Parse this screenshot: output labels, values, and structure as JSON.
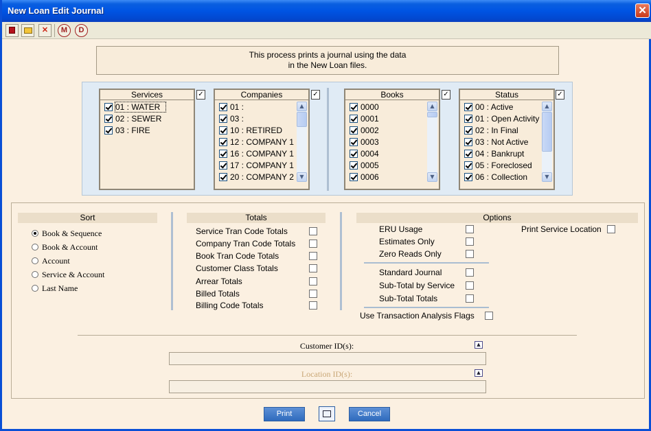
{
  "window": {
    "title": "New Loan Edit Journal",
    "close_glyph": "✕"
  },
  "toolbar": {
    "buttons": [
      {
        "name": "record-icon",
        "glyph": "▣"
      },
      {
        "name": "open-folder-icon",
        "glyph": "📂"
      },
      {
        "name": "delete-x-icon",
        "glyph": "✕"
      },
      {
        "name": "m-circle-icon",
        "glyph": "M"
      },
      {
        "name": "d-circle-icon",
        "glyph": "D"
      }
    ]
  },
  "notice": {
    "line1": "This process prints a journal using the data",
    "line2": "in the New Loan files."
  },
  "services": {
    "header": "Services",
    "items": [
      "01 : WATER",
      "02 : SEWER",
      "03 : FIRE"
    ]
  },
  "companies": {
    "header": "Companies",
    "items": [
      "01 :",
      "03 :",
      "10 : RETIRED",
      "12 : COMPANY 1",
      "16 : COMPANY 1",
      "17 : COMPANY 1",
      "20 : COMPANY 2"
    ]
  },
  "books": {
    "header": "Books",
    "items": [
      "0000",
      "0001",
      "0002",
      "0003",
      "0004",
      "0005",
      "0006"
    ]
  },
  "status": {
    "header": "Status",
    "items": [
      "00 : Active",
      "01 : Open Activity",
      "02 : In Final",
      "03 : Not Active",
      "04 : Bankrupt",
      "05 : Foreclosed",
      "06 : Collection"
    ]
  },
  "sort": {
    "header": "Sort",
    "options": [
      "Book & Sequence",
      "Book & Account",
      "Account",
      "Service & Account",
      "Last Name"
    ],
    "selected": "Book & Sequence"
  },
  "totals": {
    "header": "Totals",
    "items": [
      "Service Tran Code Totals",
      "Company Tran Code Totals",
      "Book Tran Code Totals",
      "Customer Class Totals",
      "Arrear Totals",
      "Billed Totals",
      "Billing Code Totals"
    ]
  },
  "options": {
    "header": "Options",
    "group1": [
      "ERU Usage",
      "Estimates Only",
      "Zero Reads Only"
    ],
    "group2": [
      "Standard Journal",
      "Sub-Total by Service",
      "Sub-Total Totals"
    ],
    "print_service_location": "Print Service Location",
    "use_tran_flags": "Use Transaction Analysis Flags"
  },
  "customer_ids": {
    "label": "Customer ID(s):",
    "value": ""
  },
  "location_ids": {
    "label": "Location ID(s):",
    "value": ""
  },
  "buttons": {
    "print": "Print",
    "cancel": "Cancel",
    "preview_glyph": "🔍"
  },
  "colors": {
    "title_bar": "#0054e3",
    "background": "#fbf0e1",
    "filter_panel": "#e0ebf5",
    "button": "#3a75c4",
    "disabled_label": "#c9a776"
  }
}
